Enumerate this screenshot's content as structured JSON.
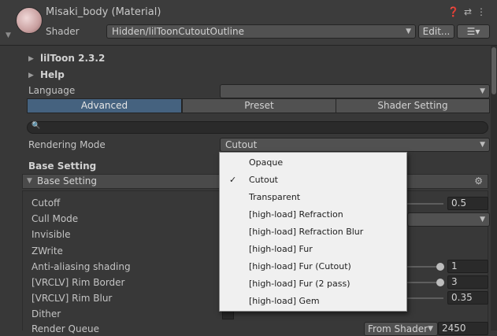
{
  "header": {
    "title": "Misaki_body (Material)",
    "shader_label": "Shader",
    "shader_value": "Hidden/lilToonCutoutOutline",
    "edit_button": "Edit...",
    "icons": [
      "help-icon",
      "preset-icon",
      "menu-icon"
    ]
  },
  "foldouts": {
    "liltoon": "lilToon 2.3.2",
    "help": "Help"
  },
  "language": {
    "label": "Language",
    "value": ""
  },
  "tabs": [
    "Advanced",
    "Preset",
    "Shader Setting"
  ],
  "search": {
    "placeholder": ""
  },
  "rendering_mode": {
    "label": "Rendering Mode",
    "value": "Cutout"
  },
  "base_setting": {
    "title": "Base Setting",
    "section_label": "Base Setting"
  },
  "properties": {
    "cutoff": {
      "label": "Cutoff",
      "value": "0.5"
    },
    "cull_mode": {
      "label": "Cull Mode"
    },
    "invisible": {
      "label": "Invisible"
    },
    "zwrite": {
      "label": "ZWrite"
    },
    "anti_aliasing": {
      "label": "Anti-aliasing shading",
      "value": "1"
    },
    "rim_border": {
      "label": "[VRCLV] Rim Border",
      "value": "3"
    },
    "rim_blur": {
      "label": "[VRCLV] Rim Blur",
      "value": "0.35"
    },
    "dither": {
      "label": "Dither"
    },
    "render_queue": {
      "label": "Render Queue",
      "source": "From Shader",
      "value": "2450"
    }
  },
  "menu": {
    "selected": "Cutout",
    "items": [
      "Opaque",
      "Cutout",
      "Transparent",
      "[high-load] Refraction",
      "[high-load] Refraction Blur",
      "[high-load] Fur",
      "[high-load] Fur (Cutout)",
      "[high-load] Fur (2 pass)",
      "[high-load] Gem"
    ]
  },
  "colors": {
    "background": "#383838",
    "active_tab": "#45627f",
    "menu_background": "#f0f0f0"
  }
}
